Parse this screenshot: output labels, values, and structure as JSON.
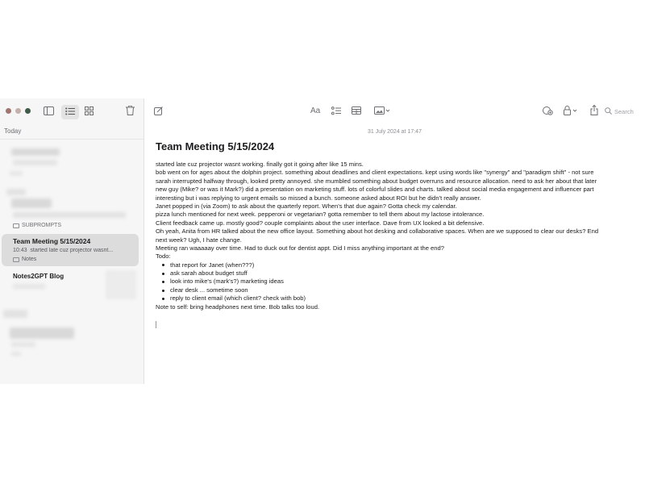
{
  "sidebar": {
    "section_label": "Today",
    "folder_label_1": "SUBPROMPTS",
    "selected_note": {
      "title": "Team Meeting 5/15/2024",
      "time": "10:43",
      "preview": "started late cuz projector wasnt...",
      "folder": "Notes"
    },
    "other_note_title": "Notes2GPT Blog"
  },
  "toolbar": {
    "search_placeholder": "Search"
  },
  "note": {
    "date_stamp": "31 July 2024 at 17:47",
    "title": "Team Meeting 5/15/2024",
    "lines": [
      "started late cuz projector wasnt working. finally got it going after like 15 mins.",
      "bob went on for ages about the dolphin project. something about deadlines and client expectations. kept using words like \"synergy\" and \"paradigm shift\" - not sure",
      "sarah interrupted halfway through, looked pretty annoyed. she mumbled something about budget overruns and resource allocation. need to ask her about that later",
      "new guy (Mike? or was it Mark?) did a presentation on marketing stuff. lots of colorful slides and charts. talked about social media engagement and influencer part",
      "interesting but i was replying to urgent emails so missed a bunch. someone asked about ROI but he didn't really answer.",
      "Janet popped in (via Zoom) to ask about the quarterly report. When's that due again? Gotta check my calendar.",
      "pizza lunch mentioned for next week. pepperoni or vegetarian? gotta remember to tell them about my lactose intolerance.",
      "Client feedback came up. mostly good? couple complaints about the user interface. Dave from UX looked a bit defensive.",
      "Oh yeah, Anita from HR talked about the new office layout. Something about hot desking and collaborative spaces. When are we supposed to clear our desks? End",
      "next week? Ugh, I hate change.",
      "Meeting ran waaaaay over time. Had to duck out for dentist appt. Did I miss anything important at the end?",
      "Todo:"
    ],
    "todos": [
      "that report for Janet (when???)",
      "ask sarah about budget stuff",
      "look into mike's (mark's?) marketing ideas",
      "clear desk ... sometime soon",
      "reply to client email (which client? check with bob)"
    ],
    "footer_line": "Note to self: bring headphones next time. Bob talks too loud."
  },
  "colors": {
    "traffic_close": "#a0756f",
    "traffic_min": "#c4b0a8",
    "traffic_max": "#3f5a48",
    "selected_card": "#dcdcdc"
  }
}
